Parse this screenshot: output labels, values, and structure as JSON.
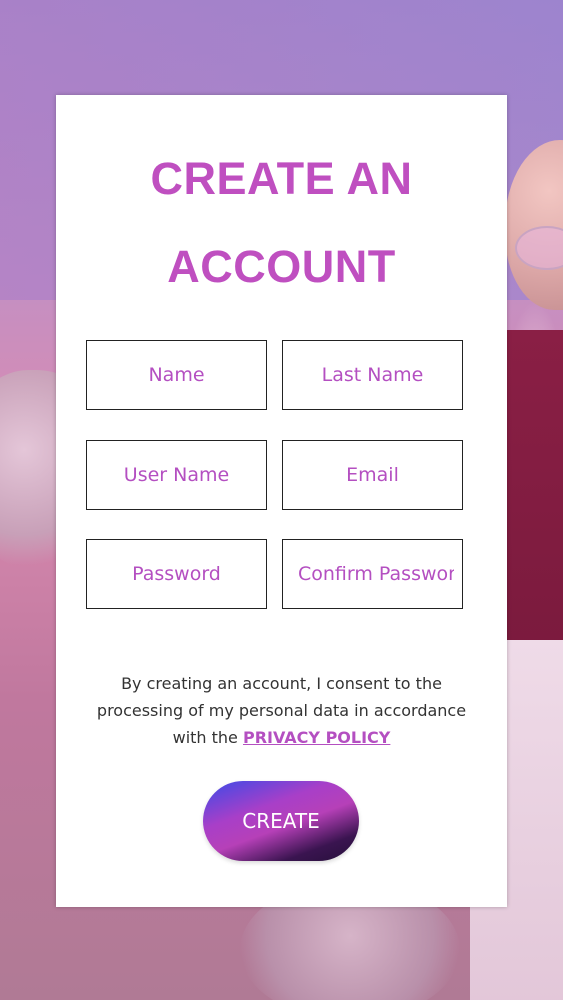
{
  "title": {
    "line1": "CREATE AN",
    "line2": "ACCOUNT"
  },
  "form": {
    "name_placeholder": "Name",
    "last_name_placeholder": "Last Name",
    "user_name_placeholder": "User Name",
    "email_placeholder": "Email",
    "password_placeholder": "Password",
    "confirm_password_placeholder": "Confirm Password"
  },
  "consent": {
    "line1": "By creating an account, I consent to the",
    "line2": "processing of my personal data in accordance",
    "line3_prefix": "with the ",
    "privacy_link": "PRIVACY POLICY"
  },
  "create_button": {
    "label": "CREATE"
  },
  "colors": {
    "accent": "#bf4fc0",
    "button_gradient_start": "#3a4be8",
    "button_gradient_mid": "#b640b8",
    "button_gradient_end": "#26103a"
  }
}
